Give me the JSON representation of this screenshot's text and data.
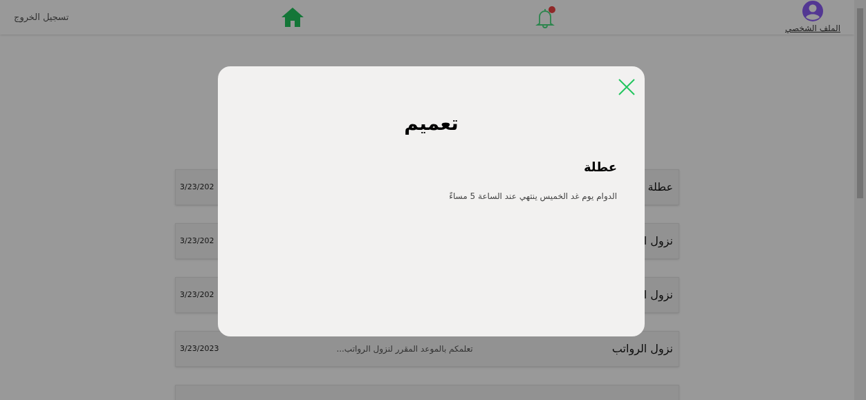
{
  "header": {
    "logout": "تسجيل الخروج",
    "notifications": {
      "unread": true
    },
    "profile": "الملف الشخصي"
  },
  "announcements": [
    {
      "title": "عطلة",
      "date": "3/23/202"
    },
    {
      "title": "نزول ا",
      "date": "3/23/202"
    },
    {
      "title": "نزول ا",
      "date": "3/23/202"
    },
    {
      "title": "نزول الرواتب",
      "summary": "تعلمكم بالموعد المقرر لنزول الرواتب...",
      "date": "3/23/2023"
    }
  ],
  "modal": {
    "title": "تعميم",
    "heading": "عطلة",
    "body": "الدوام يوم غد الخميس ينتهي عند الساعة 5 مساءً"
  }
}
